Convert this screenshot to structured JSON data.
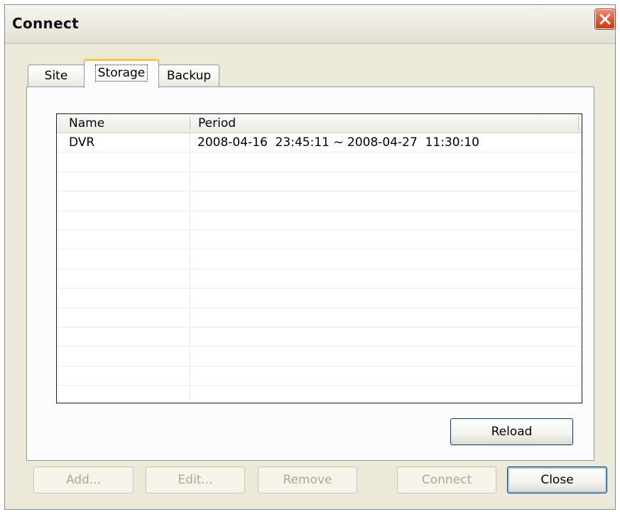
{
  "window": {
    "title": "Connect"
  },
  "tabs": [
    {
      "label": "Site",
      "selected": false
    },
    {
      "label": "Storage",
      "selected": true
    },
    {
      "label": "Backup",
      "selected": false
    }
  ],
  "storage": {
    "columns": [
      "Name",
      "Period"
    ],
    "rows": [
      {
        "name": "DVR",
        "period": "2008-04-16  23:45:11 ~ 2008-04-27  11:30:10"
      },
      {
        "name": "",
        "period": ""
      },
      {
        "name": "",
        "period": ""
      },
      {
        "name": "",
        "period": ""
      },
      {
        "name": "",
        "period": ""
      },
      {
        "name": "",
        "period": ""
      },
      {
        "name": "",
        "period": ""
      },
      {
        "name": "",
        "period": ""
      },
      {
        "name": "",
        "period": ""
      },
      {
        "name": "",
        "period": ""
      },
      {
        "name": "",
        "period": ""
      },
      {
        "name": "",
        "period": ""
      },
      {
        "name": "",
        "period": ""
      },
      {
        "name": "",
        "period": ""
      }
    ],
    "reload_label": "Reload"
  },
  "buttons": {
    "add": "Add...",
    "edit": "Edit...",
    "remove": "Remove",
    "connect": "Connect",
    "close": "Close"
  },
  "icons": {
    "close": "close-icon"
  },
  "colors": {
    "dialog_bg": "#ece9d8",
    "selected_tab_accent": "#ffc73c",
    "close_button": "#e05a33",
    "disabled_text": "#aca899"
  }
}
